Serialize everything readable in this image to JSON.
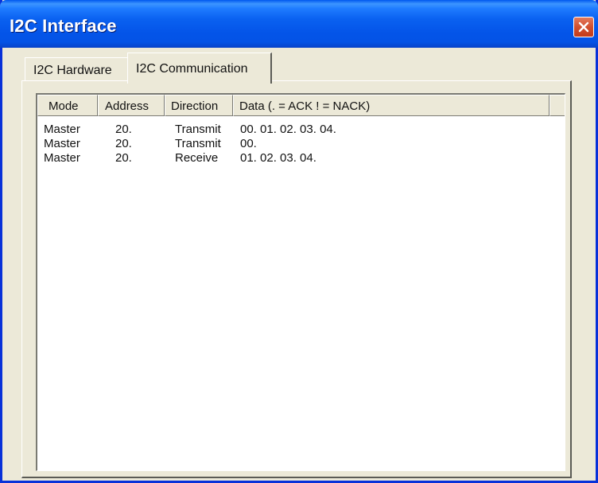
{
  "window": {
    "title": "I2C Interface",
    "title_bar_color": "#0a61f0",
    "close_button_color": "#d2502f"
  },
  "tabs": [
    {
      "label": "I2C Hardware",
      "selected": false
    },
    {
      "label": "I2C Communication",
      "selected": true
    }
  ],
  "listview": {
    "columns": [
      "Mode",
      "Address",
      "Direction",
      "Data (. = ACK   ! = NACK)"
    ],
    "rows": [
      {
        "mode": "Master",
        "address": "20.",
        "direction": "Transmit",
        "data": "00. 01. 02. 03. 04."
      },
      {
        "mode": "Master",
        "address": "20.",
        "direction": "Transmit",
        "data": "00."
      },
      {
        "mode": "Master",
        "address": "20.",
        "direction": "Receive",
        "data": "01. 02. 03. 04."
      }
    ]
  }
}
